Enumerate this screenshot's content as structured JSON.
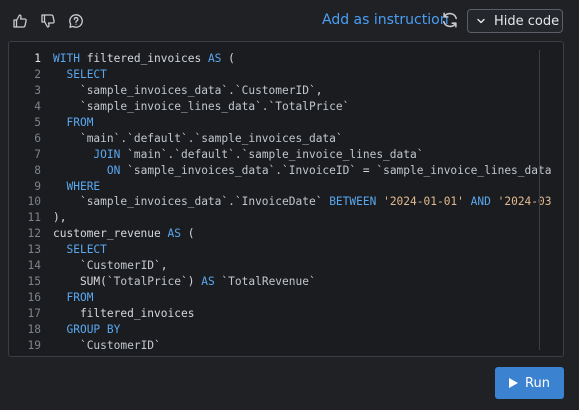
{
  "toolbar": {
    "add_instruction_label": "Add as instruction",
    "hide_code_label": "Hide code",
    "run_label": "Run"
  },
  "editor": {
    "active_line": 1,
    "lines": [
      {
        "n": "1",
        "tokens": [
          [
            "kw",
            "WITH "
          ],
          [
            "src",
            "filtered_invoices "
          ],
          [
            "kw",
            "AS"
          ],
          [
            "src",
            " ("
          ]
        ]
      },
      {
        "n": "2",
        "tokens": [
          [
            "src",
            "  "
          ],
          [
            "kw",
            "SELECT"
          ]
        ]
      },
      {
        "n": "3",
        "tokens": [
          [
            "src",
            "    "
          ],
          [
            "id",
            "`sample_invoices_data`.`CustomerID`"
          ],
          [
            "src",
            ","
          ]
        ]
      },
      {
        "n": "4",
        "tokens": [
          [
            "src",
            "    "
          ],
          [
            "id",
            "`sample_invoice_lines_data`.`TotalPrice`"
          ]
        ]
      },
      {
        "n": "5",
        "tokens": [
          [
            "src",
            "  "
          ],
          [
            "kw",
            "FROM"
          ]
        ]
      },
      {
        "n": "6",
        "tokens": [
          [
            "src",
            "    "
          ],
          [
            "id",
            "`main`.`default`.`sample_invoices_data`"
          ]
        ]
      },
      {
        "n": "7",
        "tokens": [
          [
            "src",
            "      "
          ],
          [
            "kw",
            "JOIN "
          ],
          [
            "id",
            "`main`.`default`.`sample_invoice_lines_data`"
          ]
        ]
      },
      {
        "n": "8",
        "tokens": [
          [
            "src",
            "        "
          ],
          [
            "kw",
            "ON "
          ],
          [
            "id",
            "`sample_invoices_data`.`InvoiceID`"
          ],
          [
            "src",
            " = "
          ],
          [
            "id",
            "`sample_invoice_lines_data"
          ]
        ]
      },
      {
        "n": "9",
        "tokens": [
          [
            "src",
            "  "
          ],
          [
            "kw",
            "WHERE"
          ]
        ]
      },
      {
        "n": "10",
        "tokens": [
          [
            "src",
            "    "
          ],
          [
            "id",
            "`sample_invoices_data`.`InvoiceDate`"
          ],
          [
            "src",
            " "
          ],
          [
            "kw",
            "BETWEEN "
          ],
          [
            "str",
            "'2024-01-01'"
          ],
          [
            "src",
            " "
          ],
          [
            "kw",
            "AND "
          ],
          [
            "str",
            "'2024-03"
          ]
        ]
      },
      {
        "n": "11",
        "tokens": [
          [
            "src",
            "),"
          ]
        ]
      },
      {
        "n": "12",
        "tokens": [
          [
            "src",
            "customer_revenue "
          ],
          [
            "kw",
            "AS"
          ],
          [
            "src",
            " ("
          ]
        ]
      },
      {
        "n": "13",
        "tokens": [
          [
            "src",
            "  "
          ],
          [
            "kw",
            "SELECT"
          ]
        ]
      },
      {
        "n": "14",
        "tokens": [
          [
            "src",
            "    "
          ],
          [
            "id",
            "`CustomerID`"
          ],
          [
            "src",
            ","
          ]
        ]
      },
      {
        "n": "15",
        "tokens": [
          [
            "src",
            "    SUM("
          ],
          [
            "id",
            "`TotalPrice`"
          ],
          [
            "src",
            ") "
          ],
          [
            "kw",
            "AS "
          ],
          [
            "id",
            "`TotalRevenue`"
          ]
        ]
      },
      {
        "n": "16",
        "tokens": [
          [
            "src",
            "  "
          ],
          [
            "kw",
            "FROM"
          ]
        ]
      },
      {
        "n": "17",
        "tokens": [
          [
            "src",
            "    filtered_invoices"
          ]
        ]
      },
      {
        "n": "18",
        "tokens": [
          [
            "src",
            "  "
          ],
          [
            "kw",
            "GROUP BY"
          ]
        ]
      },
      {
        "n": "19",
        "tokens": [
          [
            "src",
            "    "
          ],
          [
            "id",
            "`CustomerID`"
          ]
        ]
      }
    ]
  },
  "icons": {
    "like": "thumbs-up-icon",
    "dislike": "thumbs-down-icon",
    "feedback": "comment-question-icon",
    "refresh": "refresh-icon",
    "collapse": "chevron-down-icon",
    "run": "play-icon"
  }
}
